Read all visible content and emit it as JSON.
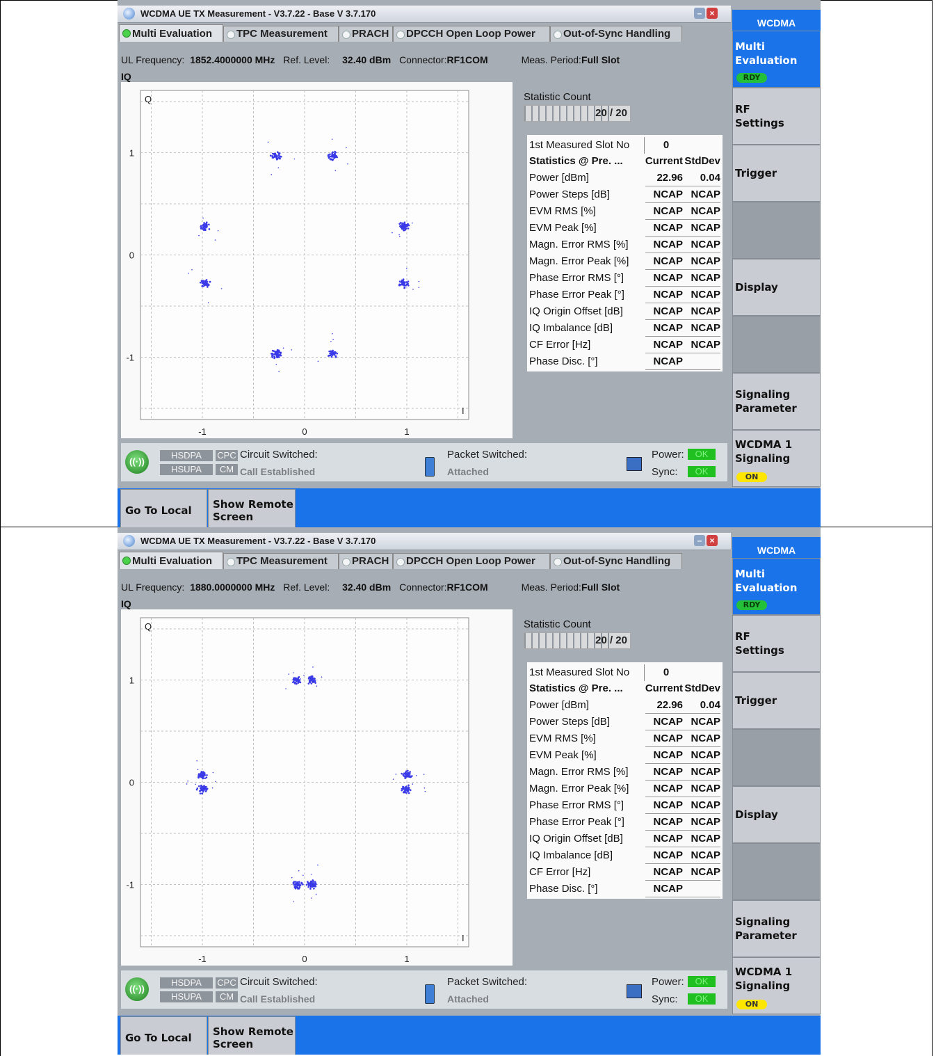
{
  "screens": [
    {
      "window": {
        "title": "WCDMA UE TX Measurement  - V3.7.22 - Base V 3.7.170",
        "minimize_icon": "minimize-icon",
        "close_icon": "close-icon"
      },
      "tabs": [
        "Multi Evaluation",
        "TPC Measurement",
        "PRACH",
        "DPCCH Open Loop Power",
        "Out-of-Sync Handling"
      ],
      "info": {
        "ul_frequency_label": "UL Frequency:",
        "ul_frequency_value": "1852.4000000 MHz",
        "ref_level_label": "Ref. Level:",
        "ref_level_value": "32.40 dBm",
        "connector_label": "Connector:",
        "connector_value": "RF1COM",
        "meas_period_label": "Meas. Period:",
        "meas_period_value": "Full Slot"
      },
      "iq_label": "IQ",
      "plot": {
        "q_label": "Q",
        "i_label": "I",
        "x_ticks": [
          "-1",
          "0",
          "1"
        ],
        "y_ticks": [
          "1",
          "0",
          "-1"
        ],
        "clusters": [
          [
            -0.28,
            0.97
          ],
          [
            0.28,
            0.97
          ],
          [
            -0.97,
            0.28
          ],
          [
            0.97,
            0.28
          ],
          [
            -0.97,
            -0.28
          ],
          [
            0.97,
            -0.28
          ],
          [
            -0.28,
            -0.97
          ],
          [
            0.28,
            -0.97
          ]
        ],
        "point_color": "#3a3ae8"
      },
      "statistic": {
        "label": "Statistic Count",
        "value": "20 / 20",
        "fraction": 1.0
      },
      "table": {
        "slot_label": "1st Measured Slot No",
        "slot_value": "0",
        "header": {
          "label": "Statistics @ Pre. ...",
          "col1": "Current",
          "col2": "StdDev"
        },
        "rows": [
          {
            "label": "Power [dBm]",
            "current": "22.96",
            "stddev": "0.04"
          },
          {
            "label": "Power Steps [dB]",
            "current": "NCAP",
            "stddev": "NCAP"
          },
          {
            "label": "EVM RMS [%]",
            "current": "NCAP",
            "stddev": "NCAP"
          },
          {
            "label": "EVM Peak [%]",
            "current": "NCAP",
            "stddev": "NCAP"
          },
          {
            "label": "Magn. Error RMS [%]",
            "current": "NCAP",
            "stddev": "NCAP"
          },
          {
            "label": "Magn. Error Peak [%]",
            "current": "NCAP",
            "stddev": "NCAP"
          },
          {
            "label": "Phase Error RMS [°]",
            "current": "NCAP",
            "stddev": "NCAP"
          },
          {
            "label": "Phase Error Peak [°]",
            "current": "NCAP",
            "stddev": "NCAP"
          },
          {
            "label": "IQ Origin Offset [dB]",
            "current": "NCAP",
            "stddev": "NCAP"
          },
          {
            "label": "IQ Imbalance [dB]",
            "current": "NCAP",
            "stddev": "NCAP"
          },
          {
            "label": "CF Error [Hz]",
            "current": "NCAP",
            "stddev": "NCAP"
          },
          {
            "label": "Phase Disc. [°]",
            "current": "NCAP",
            "stddev": ""
          }
        ]
      },
      "status": {
        "hsdpa": "HSDPA",
        "hsupa": "HSUPA",
        "cpc": "CPC",
        "cm": "CM",
        "circuit_label": "Circuit Switched:",
        "circuit_value": "Call Established",
        "packet_label": "Packet Switched:",
        "packet_value": "Attached",
        "power_label": "Power:",
        "power_value": "OK",
        "sync_label": "Sync:",
        "sync_value": "OK"
      },
      "softkeys": {
        "header": "WCDMA",
        "multi_eval": "Multi\nEvaluation",
        "multi_eval_badge": "RDY",
        "rf_settings": "RF\nSettings",
        "trigger": "Trigger",
        "display": "Display",
        "signaling_param": "Signaling\nParameter",
        "wcdma_signaling": "WCDMA 1\nSignaling",
        "wcdma_signaling_badge": "ON"
      },
      "bottom": {
        "go_to_local": "Go To Local",
        "show_remote": "Show Remote\nScreen"
      }
    },
    {
      "window": {
        "title": "WCDMA UE TX Measurement  - V3.7.22 - Base V 3.7.170",
        "minimize_icon": "minimize-icon",
        "close_icon": "close-icon"
      },
      "tabs": [
        "Multi Evaluation",
        "TPC Measurement",
        "PRACH",
        "DPCCH Open Loop Power",
        "Out-of-Sync Handling"
      ],
      "info": {
        "ul_frequency_label": "UL Frequency:",
        "ul_frequency_value": "1880.0000000 MHz",
        "ref_level_label": "Ref. Level:",
        "ref_level_value": "32.40 dBm",
        "connector_label": "Connector:",
        "connector_value": "RF1COM",
        "meas_period_label": "Meas. Period:",
        "meas_period_value": "Full Slot"
      },
      "iq_label": "IQ",
      "plot": {
        "q_label": "Q",
        "i_label": "I",
        "x_ticks": [
          "-1",
          "0",
          "1"
        ],
        "y_ticks": [
          "1",
          "0",
          "-1"
        ],
        "clusters": [
          [
            -0.07,
            1.0
          ],
          [
            0.07,
            1.0
          ],
          [
            -1.0,
            0.07
          ],
          [
            -1.0,
            -0.07
          ],
          [
            1.0,
            0.07
          ],
          [
            1.0,
            -0.07
          ],
          [
            -0.07,
            -1.0
          ],
          [
            0.07,
            -1.0
          ]
        ],
        "point_color": "#3a3ae8"
      },
      "statistic": {
        "label": "Statistic Count",
        "value": "20 / 20",
        "fraction": 1.0
      },
      "table": {
        "slot_label": "1st Measured Slot No",
        "slot_value": "0",
        "header": {
          "label": "Statistics @ Pre. ...",
          "col1": "Current",
          "col2": "StdDev"
        },
        "rows": [
          {
            "label": "Power [dBm]",
            "current": "22.96",
            "stddev": "0.04"
          },
          {
            "label": "Power Steps [dB]",
            "current": "NCAP",
            "stddev": "NCAP"
          },
          {
            "label": "EVM RMS [%]",
            "current": "NCAP",
            "stddev": "NCAP"
          },
          {
            "label": "EVM Peak [%]",
            "current": "NCAP",
            "stddev": "NCAP"
          },
          {
            "label": "Magn. Error RMS [%]",
            "current": "NCAP",
            "stddev": "NCAP"
          },
          {
            "label": "Magn. Error Peak [%]",
            "current": "NCAP",
            "stddev": "NCAP"
          },
          {
            "label": "Phase Error RMS [°]",
            "current": "NCAP",
            "stddev": "NCAP"
          },
          {
            "label": "Phase Error Peak [°]",
            "current": "NCAP",
            "stddev": "NCAP"
          },
          {
            "label": "IQ Origin Offset [dB]",
            "current": "NCAP",
            "stddev": "NCAP"
          },
          {
            "label": "IQ Imbalance [dB]",
            "current": "NCAP",
            "stddev": "NCAP"
          },
          {
            "label": "CF Error [Hz]",
            "current": "NCAP",
            "stddev": "NCAP"
          },
          {
            "label": "Phase Disc. [°]",
            "current": "NCAP",
            "stddev": ""
          }
        ]
      },
      "status": {
        "hsdpa": "HSDPA",
        "hsupa": "HSUPA",
        "cpc": "CPC",
        "cm": "CM",
        "circuit_label": "Circuit Switched:",
        "circuit_value": "Call Established",
        "packet_label": "Packet Switched:",
        "packet_value": "Attached",
        "power_label": "Power:",
        "power_value": "OK",
        "sync_label": "Sync:",
        "sync_value": "OK"
      },
      "softkeys": {
        "header": "WCDMA",
        "multi_eval": "Multi\nEvaluation",
        "multi_eval_badge": "RDY",
        "rf_settings": "RF\nSettings",
        "trigger": "Trigger",
        "display": "Display",
        "signaling_param": "Signaling\nParameter",
        "wcdma_signaling": "WCDMA 1\nSignaling",
        "wcdma_signaling_badge": "ON"
      },
      "bottom": {
        "go_to_local": "Go To Local",
        "show_remote": "Show Remote\nScreen"
      }
    }
  ]
}
